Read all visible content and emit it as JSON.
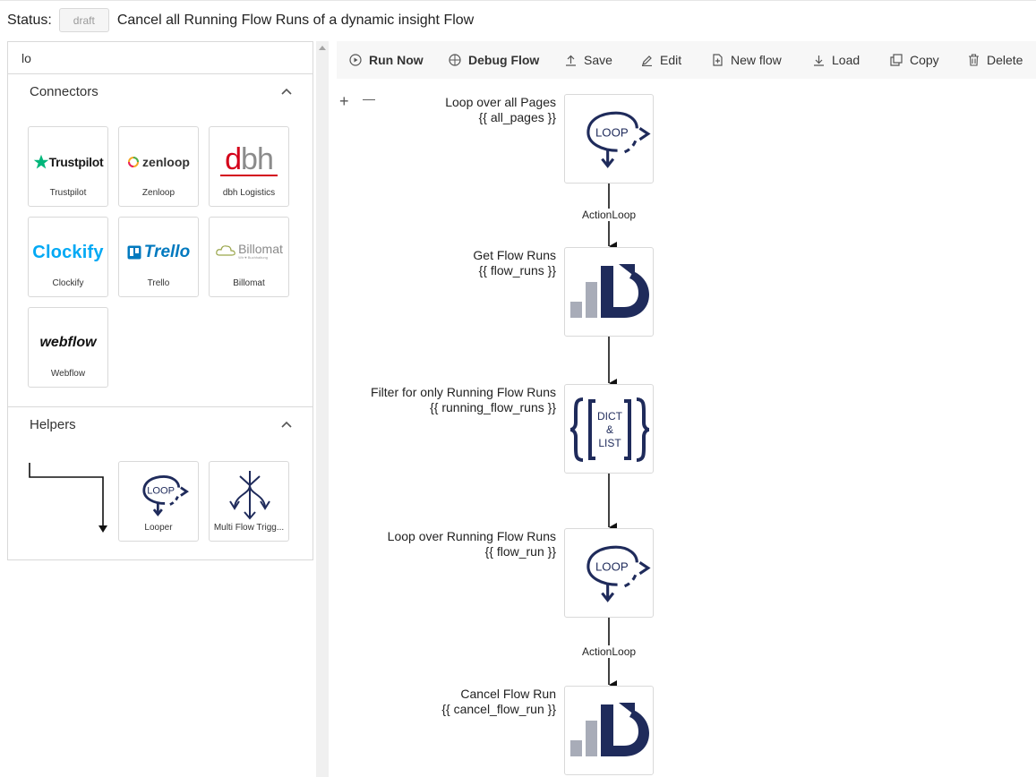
{
  "status": {
    "label": "Status:",
    "badge": "draft",
    "title": "Cancel all Running Flow Runs of a dynamic insight Flow"
  },
  "search": {
    "value": "lo"
  },
  "sections": {
    "connectors": {
      "title": "Connectors"
    },
    "helpers": {
      "title": "Helpers"
    }
  },
  "connectors": [
    {
      "name": "Trustpilot",
      "logo_text": "Trustpilot"
    },
    {
      "name": "Zenloop",
      "logo_text": "zenloop"
    },
    {
      "name": "dbh Logistics",
      "logo_text": "dbh"
    },
    {
      "name": "Clockify",
      "logo_text": "Clockify"
    },
    {
      "name": "Trello",
      "logo_text": "Trello"
    },
    {
      "name": "Billomat",
      "logo_text": "Billomat",
      "logo_sub": "Wir ♥ Buchhaltung"
    },
    {
      "name": "Webflow",
      "logo_text": "webflow"
    }
  ],
  "helpers": [
    {
      "name": "Looper",
      "logo_text": "LOOP"
    },
    {
      "name": "Multi Flow Trigg..."
    }
  ],
  "toolbar": {
    "run_now": "Run Now",
    "debug_flow": "Debug Flow",
    "save": "Save",
    "edit": "Edit",
    "new_flow": "New flow",
    "load": "Load",
    "copy": "Copy",
    "delete": "Delete"
  },
  "zoom": {
    "plus": "+",
    "minus": "—"
  },
  "nodes": [
    {
      "title": "Loop over all Pages",
      "var": "{{ all_pages }}",
      "icon": "loop-icon",
      "icon_text": "LOOP"
    },
    {
      "title": "Get Flow Runs",
      "var": "{{ flow_runs }}",
      "icon": "insight-icon"
    },
    {
      "title": "Filter for only Running Flow Runs",
      "var": "{{ running_flow_runs }}",
      "icon": "dict-list-icon",
      "icon_text": [
        "DICT",
        "&",
        "LIST"
      ]
    },
    {
      "title": "Loop over Running Flow Runs",
      "var": "{{ flow_run }}",
      "icon": "loop-icon",
      "icon_text": "LOOP"
    },
    {
      "title": "Cancel Flow Run",
      "var": "{{ cancel_flow_run }}",
      "icon": "insight-icon"
    }
  ],
  "edges": [
    {
      "label": "ActionLoop"
    },
    {
      "label": ""
    },
    {
      "label": ""
    },
    {
      "label": "ActionLoop"
    }
  ],
  "colors": {
    "navy": "#1f2b5b",
    "grey": "#a8acb8",
    "trustpilot": "#00b67a",
    "dbh": "#d4001a",
    "trello": "#0079bf",
    "clockify": "#03a9f4"
  }
}
